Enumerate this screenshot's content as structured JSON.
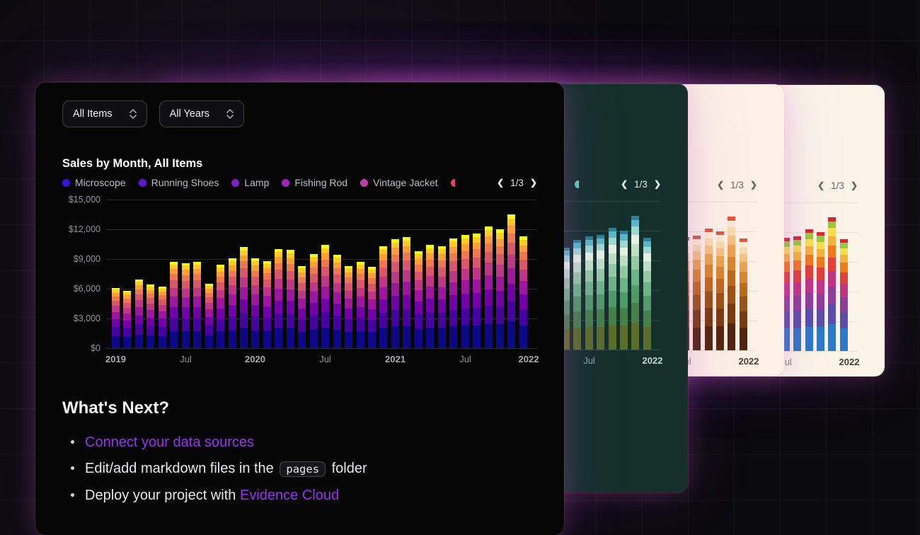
{
  "page": {
    "link_color": "#9b30f0",
    "background": "#0b0a0d"
  },
  "filters": [
    {
      "label": "All Items"
    },
    {
      "label": "All Years"
    }
  ],
  "cards": [
    {
      "name": "dark-purple-theme",
      "theme": {
        "bg": "#060607",
        "title": "#ffffff",
        "legend": "#b9bdc6",
        "pager": "#e4e4e7",
        "axis": "#8d939c",
        "axisBold": "#a8adb5",
        "grid": "#2a2a2f"
      },
      "legend_dots": [
        "#2b1bd9",
        "#5f17cf",
        "#801cc9",
        "#a323bf",
        "#bf3bb0"
      ],
      "extra_dot": "#e0455e",
      "palette": [
        "#0d0887",
        "#46039f",
        "#7201a8",
        "#9c179e",
        "#bd3786",
        "#d8576b",
        "#ed7953",
        "#fb9f3a",
        "#fdca26",
        "#f0f921"
      ]
    },
    {
      "name": "dark-teal-theme",
      "theme": {
        "bg": "#15302a",
        "title": "#e9f1ed",
        "legend": "#bccbc4",
        "pager": "#e2ebe6",
        "axis": "#93a8a0",
        "axisBold": "#c6d6cf",
        "grid": "#2d4a42"
      },
      "legend_dots": [
        "#3f7a45",
        "#52996b",
        "#6fb389",
        "#93c9a7",
        "#bcdfc6"
      ],
      "extra_dot": "#5fd0b5",
      "palette": [
        "#5b6e2a",
        "#47804c",
        "#52996b",
        "#6fb389",
        "#93c9a7",
        "#bcdfc6",
        "#e3f1e5",
        "#9fd8d2",
        "#5cb8c4",
        "#2f7f96"
      ]
    },
    {
      "name": "cream-orange-theme",
      "theme": {
        "bg": "#fdf1e5",
        "title": "#2b2622",
        "legend": "#6a6258",
        "pager": "#6f675d",
        "axis": "#8a8178",
        "axisBold": "#45403a",
        "grid": "#e8dccb"
      },
      "legend_dots": [
        "#7a3b10",
        "#9c5215",
        "#bd6a1e",
        "#d98530",
        "#eaa352"
      ],
      "extra_dot": "#e07b39",
      "palette": [
        "#53250c",
        "#7a3b10",
        "#9c5215",
        "#bd6a1e",
        "#d98530",
        "#eaa352",
        "#f5c27e",
        "#fad9ab",
        "#fdead0",
        "#e2573c"
      ]
    },
    {
      "name": "cream-rainbow-theme",
      "theme": {
        "bg": "#fbf5e8",
        "title": "#2b2622",
        "legend": "#5f5a52",
        "pager": "#6f675d",
        "axis": "#8a8178",
        "axisBold": "#45403a",
        "grid": "#e9e2d1"
      },
      "legend_dots": [
        "#2e79c7",
        "#6a4fb3",
        "#a03a9c",
        "#d23a6e",
        "#e8622c"
      ],
      "extra_dot": "#7bc043",
      "palette": [
        "#2e79c7",
        "#5b4ea8",
        "#8f3f97",
        "#c13584",
        "#e2403a",
        "#ef7b1a",
        "#f6b33c",
        "#f9e04d",
        "#9ac93d",
        "#cc2d36"
      ]
    }
  ],
  "chart_data": {
    "type": "bar",
    "stacked": true,
    "title": "Sales by Month, All Items",
    "legend_items": [
      "Microscope",
      "Running Shoes",
      "Lamp",
      "Fishing Rod",
      "Vintage Jacket"
    ],
    "pager": {
      "prev": "❮",
      "current": "1/3",
      "next": "❯"
    },
    "x": [
      "2019-01",
      "2019-02",
      "2019-03",
      "2019-04",
      "2019-05",
      "2019-06",
      "2019-07",
      "2019-08",
      "2019-09",
      "2019-10",
      "2019-11",
      "2019-12",
      "2020-01",
      "2020-02",
      "2020-03",
      "2020-04",
      "2020-05",
      "2020-06",
      "2020-07",
      "2020-08",
      "2020-09",
      "2020-10",
      "2020-11",
      "2020-12",
      "2021-01",
      "2021-02",
      "2021-03",
      "2021-04",
      "2021-05",
      "2021-06",
      "2021-07",
      "2021-08",
      "2021-09",
      "2021-10",
      "2021-11",
      "2021-12"
    ],
    "totals": [
      6100,
      5800,
      6900,
      6400,
      6200,
      8700,
      8600,
      8700,
      6500,
      8400,
      9100,
      10200,
      9100,
      8800,
      10000,
      9900,
      8300,
      9500,
      10400,
      9400,
      8300,
      8700,
      8200,
      10300,
      11000,
      11200,
      9800,
      10400,
      10300,
      11100,
      11400,
      11600,
      12300,
      12000,
      13500,
      11300
    ],
    "segment_proportions": [
      0.2,
      0.15,
      0.13,
      0.12,
      0.1,
      0.09,
      0.07,
      0.06,
      0.05,
      0.03
    ],
    "ylim": [
      0,
      15000
    ],
    "y_ticks": [
      15000,
      12000,
      9000,
      6000,
      3000,
      0
    ],
    "y_tick_labels": [
      "$15,000",
      "$12,000",
      "$9,000",
      "$6,000",
      "$3,000",
      "$0"
    ],
    "x_ticks": [
      {
        "index": 0,
        "label": "2019",
        "bold": true
      },
      {
        "index": 6,
        "label": "Jul",
        "bold": false
      },
      {
        "index": 12,
        "label": "2020",
        "bold": true
      },
      {
        "index": 18,
        "label": "Jul",
        "bold": false
      },
      {
        "index": 24,
        "label": "2021",
        "bold": true
      },
      {
        "index": 30,
        "label": "Jul",
        "bold": false
      },
      {
        "index": 36,
        "label": "2022",
        "bold": true
      }
    ],
    "legend_position": "top",
    "grid": true
  },
  "whats_next": {
    "heading": "What's Next?",
    "items": [
      {
        "text": "Connect your data sources"
      },
      {
        "prefix": "Edit/add markdown files in the ",
        "code": "pages",
        "suffix": " folder"
      },
      {
        "prefix": "Deploy your project with ",
        "link": "Evidence Cloud"
      }
    ]
  }
}
